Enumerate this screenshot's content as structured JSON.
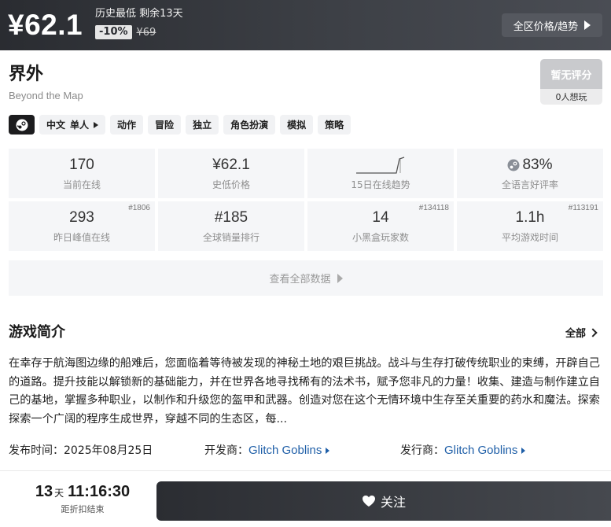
{
  "price_bar": {
    "current_price": "¥62.1",
    "label": "历史最低 剩余13天",
    "discount": "-10%",
    "original_price": "¥69",
    "region_button": "全区价格/趋势"
  },
  "game": {
    "title": "界外",
    "subtitle": "Beyond the Map",
    "rating_label": "暂无评分",
    "want_count": "0人想玩"
  },
  "tags": {
    "language": "中文",
    "mode": "单人",
    "genres": [
      "动作",
      "冒险",
      "独立",
      "角色扮演",
      "模拟",
      "策略"
    ]
  },
  "stats": [
    {
      "value": "170",
      "label": "当前在线",
      "rank": ""
    },
    {
      "value": "¥62.1",
      "label": "史低价格",
      "rank": ""
    },
    {
      "value": "",
      "label": "15日在线趋势",
      "rank": ""
    },
    {
      "value": "83%",
      "label": "全语言好评率",
      "rank": ""
    },
    {
      "value": "293",
      "label": "昨日峰值在线",
      "rank": "#1806"
    },
    {
      "value": "#185",
      "label": "全球销量排行",
      "rank": ""
    },
    {
      "value": "14",
      "label": "小黑盒玩家数",
      "rank": "#134118"
    },
    {
      "value": "1.1h",
      "label": "平均游戏时间",
      "rank": "#113191"
    }
  ],
  "all_data_label": "查看全部数据",
  "intro": {
    "title": "游戏简介",
    "all_label": "全部",
    "text": "在幸存于航海图边缘的船难后，您面临着等待被发现的神秘土地的艰巨挑战。战斗与生存打破传统职业的束缚，开辟自己的道路。提升技能以解锁新的基础能力，并在世界各地寻找稀有的法术书，赋予您非凡的力量！收集、建造与制作建立自己的基地，掌握多种职业，以制作和升级您的盔甲和武器。创造对您在这个无情环境中生存至关重要的药水和魔法。探索 探索一个广阔的程序生成世界，穿越不同的生态区，每..."
  },
  "meta": {
    "release_label": "发布时间：",
    "release_date": "2025年08月25日",
    "developer_label": "开发商：",
    "developer": "Glitch Goblins",
    "publisher_label": "发行商：",
    "publisher": "Glitch Goblins"
  },
  "countdown": {
    "days": "13",
    "days_unit": "天",
    "time": "11:16:30",
    "label": "距折扣结束"
  },
  "follow_button": "关注",
  "icons": [
    "steam-icon",
    "chevron-right-icon",
    "heart-icon",
    "steam-rating-icon",
    "sparkline-icon"
  ]
}
